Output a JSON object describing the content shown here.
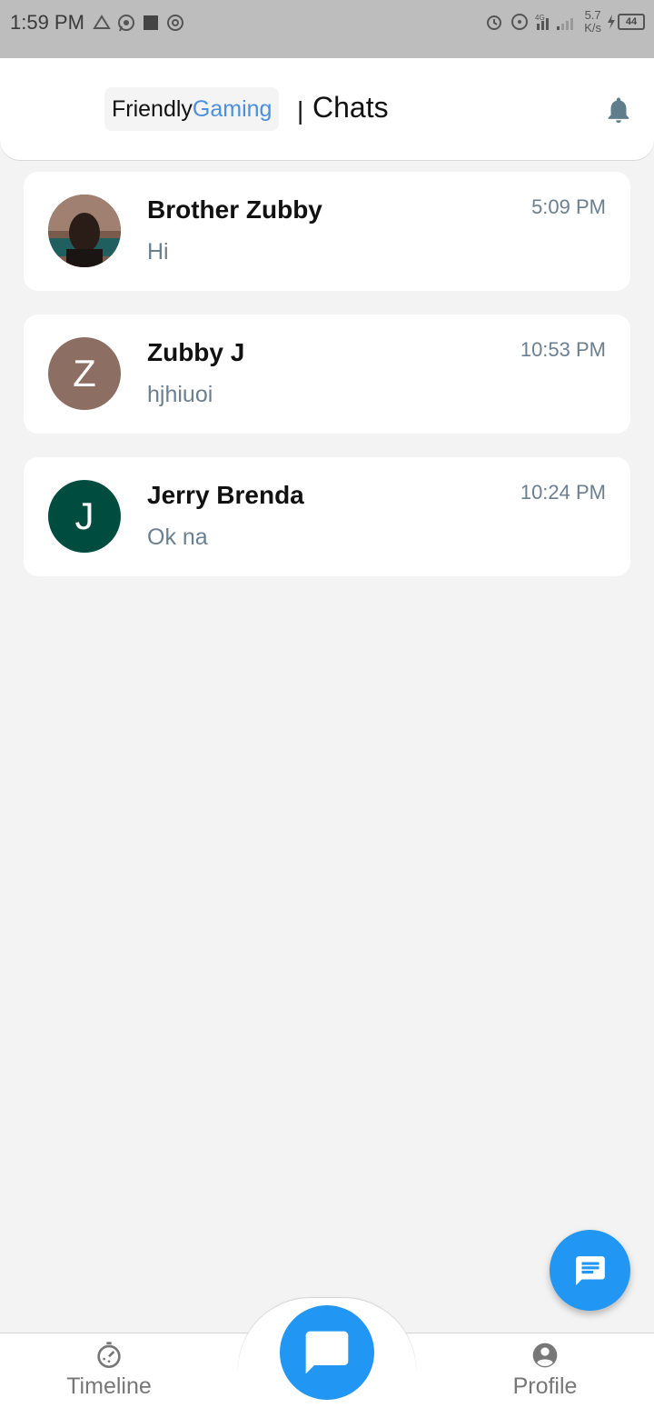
{
  "status_bar": {
    "time": "1:59 PM",
    "speed_value": "5.7",
    "speed_unit": "K/s",
    "battery": "44"
  },
  "header": {
    "brand_part1": "Friendly",
    "brand_part2": "Gaming",
    "divider": "|",
    "title": "Chats",
    "brand_color": "#4a8fe0"
  },
  "chats": [
    {
      "name": "Brother Zubby",
      "preview": "Hi",
      "time": "5:09 PM",
      "avatar_type": "photo",
      "avatar_letter": ""
    },
    {
      "name": "Zubby J",
      "preview": "hjhiuoi",
      "time": "10:53 PM",
      "avatar_type": "letter",
      "avatar_letter": "Z",
      "avatar_color": "#8d6e63"
    },
    {
      "name": "Jerry Brenda",
      "preview": "Ok na",
      "time": "10:24 PM",
      "avatar_type": "letter",
      "avatar_letter": "J",
      "avatar_color": "#004d40"
    }
  ],
  "bottom_nav": {
    "timeline_label": "Timeline",
    "profile_label": "Profile"
  },
  "colors": {
    "accent": "#2196f3",
    "muted_text": "#6a7f8f"
  }
}
